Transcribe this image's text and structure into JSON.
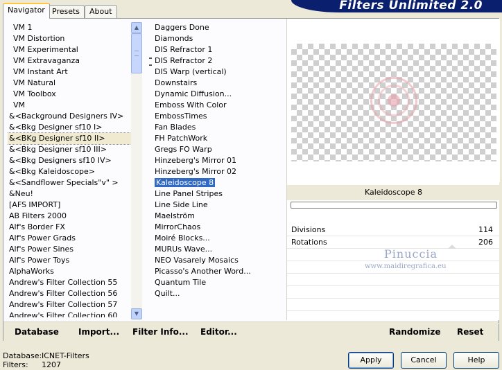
{
  "banner": "Filters Unlimited 2.0",
  "tabs": [
    "Navigator",
    "Presets",
    "About"
  ],
  "categories": [
    "VM 1",
    "VM Distortion",
    "VM Experimental",
    "VM Extravaganza",
    "VM Instant Art",
    "VM Natural",
    "VM Toolbox",
    "VM",
    "&<Background Designers IV>",
    "&<Bkg Designer sf10 I>",
    "&<BKg Designer sf10 II>",
    "&<Bkg Designer sf10 III>",
    "&<Bkg Designers sf10 IV>",
    "&<Bkg Kaleidoscope>",
    "&<Sandflower Specials\"v\" >",
    "&Neu!",
    "[AFS IMPORT]",
    "AB Filters 2000",
    "Alf's Border FX",
    "Alf's Power Grads",
    "Alf's Power Sines",
    "Alf's Power Toys",
    "AlphaWorks",
    "Andrew's Filter Collection 55",
    "Andrew's Filter Collection 56",
    "Andrew's Filter Collection 57",
    "Andrew's Filter Collection 60"
  ],
  "filters": [
    "Daggers Done",
    "Diamonds",
    "DIS Refractor 1",
    "DIS Refractor 2",
    "DIS Warp (vertical)",
    "Downstairs",
    "Dynamic Diffusion...",
    "Emboss With Color",
    "EmbossTimes",
    "Fan Blades",
    "FH PatchWork",
    "Gregs FO Warp",
    "Hinzeberg's Mirror 01",
    "Hinzeberg's Mirror 02",
    "Kaleidoscope 8",
    "Line Panel Stripes",
    "Line Side Line",
    "Maelström",
    "MirrorChaos",
    "Moiré Blocks...",
    "MURUs Wave...",
    "NEO Vasarely Mosaics",
    "Picasso's Another Word...",
    "Quantum Tile",
    "Quilt..."
  ],
  "selected_filter": "Kaleidoscope 8",
  "params": [
    {
      "label": "Divisions",
      "value": "114"
    },
    {
      "label": "Rotations",
      "value": "206"
    }
  ],
  "watermark": {
    "line1": "Pinuccia",
    "line2": "www.maidiregrafica.eu"
  },
  "toolbar": {
    "database": "Database",
    "import": "Import...",
    "filter_info": "Filter Info...",
    "editor": "Editor...",
    "randomize": "Randomize",
    "reset": "Reset"
  },
  "status": {
    "database_label": "Database:",
    "database_value": "ICNET-Filters",
    "filters_label": "Filters:",
    "filters_value": "1207"
  },
  "buttons": {
    "apply": "Apply",
    "cancel": "Cancel",
    "help": "Help"
  }
}
